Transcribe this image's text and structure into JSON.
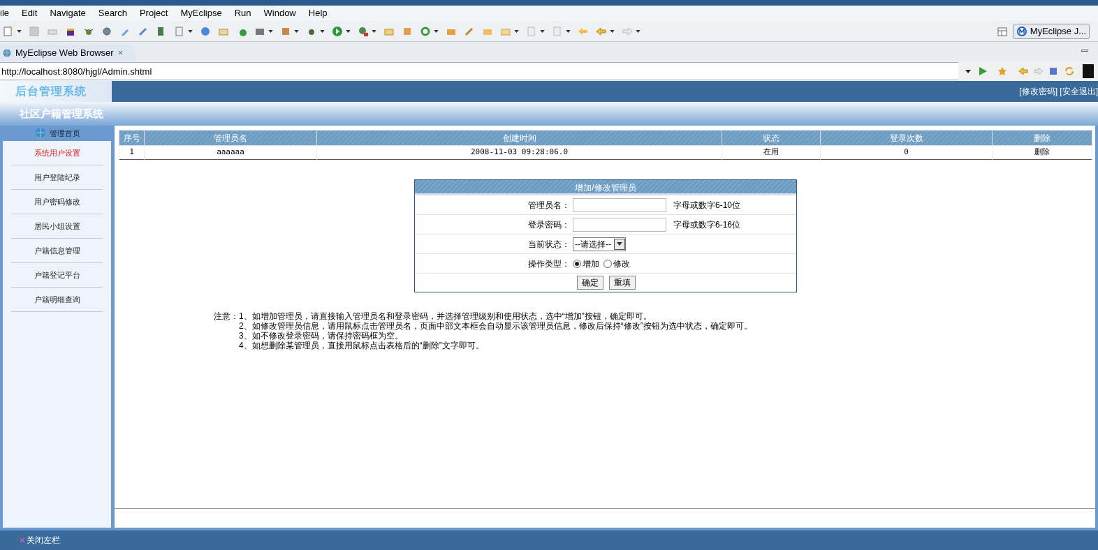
{
  "menu": [
    "ile",
    "Edit",
    "Navigate",
    "Search",
    "Project",
    "MyEclipse",
    "Run",
    "Window",
    "Help"
  ],
  "perspective": {
    "label": "MyEclipse J..."
  },
  "editor_tab": {
    "label": "MyEclipse Web Browser",
    "close": "×"
  },
  "address": {
    "value": "http://localhost:8080/hjgl/Admin.shtml"
  },
  "page": {
    "logo": "后台管理系统",
    "top_links": "[修改密码] [安全退出]",
    "subtitle": "社区户籍管理系统",
    "sidebar": {
      "home": "管理首页",
      "items": [
        {
          "label": "系统用户设置",
          "selected": true
        },
        {
          "label": "用户登陆纪录",
          "selected": false
        },
        {
          "label": "用户密码修改",
          "selected": false
        },
        {
          "label": "居民小组设置",
          "selected": false
        },
        {
          "label": "户籍信息管理",
          "selected": false
        },
        {
          "label": "户籍登记平台",
          "selected": false
        },
        {
          "label": "户籍明细查询",
          "selected": false
        }
      ]
    },
    "table": {
      "columns": [
        "序号",
        "管理员名",
        "创建时间",
        "状态",
        "登录次数",
        "删除"
      ],
      "rows": [
        [
          "1",
          "aaaaaa",
          "2008-11-03 09:28:06.0",
          "在用",
          "0",
          "删除"
        ]
      ]
    },
    "form": {
      "title": "增加/修改管理员",
      "fields": [
        {
          "label": "管理员名：",
          "kind": "text",
          "hint": "字母或数字6-10位"
        },
        {
          "label": "登录密码：",
          "kind": "password",
          "hint": "字母或数字6-16位"
        },
        {
          "label": "当前状态：",
          "kind": "select",
          "value": "--请选择--"
        },
        {
          "label": "操作类型：",
          "kind": "radio",
          "options": [
            {
              "label": "增加",
              "selected": true
            },
            {
              "label": "修改",
              "selected": false
            }
          ]
        }
      ],
      "buttons": [
        "确定",
        "重填"
      ]
    },
    "notes": [
      "注意：1、如增加管理员，请直接输入管理员名和登录密码，并选择管理级别和使用状态，选中“增加”按钮，确定即可。",
      "2、如修改管理员信息，请用鼠标点击管理员名，页面中部文本框会自动显示该管理员信息，修改后保持“修改”按钮为选中状态，确定即可。",
      "3、如不修改登录密码，请保持密码框为空。",
      "4、如想删除某管理员，直接用鼠标点击表格后的“删除”文字即可。"
    ],
    "footer": {
      "close_sidebar": "关闭左栏"
    }
  }
}
